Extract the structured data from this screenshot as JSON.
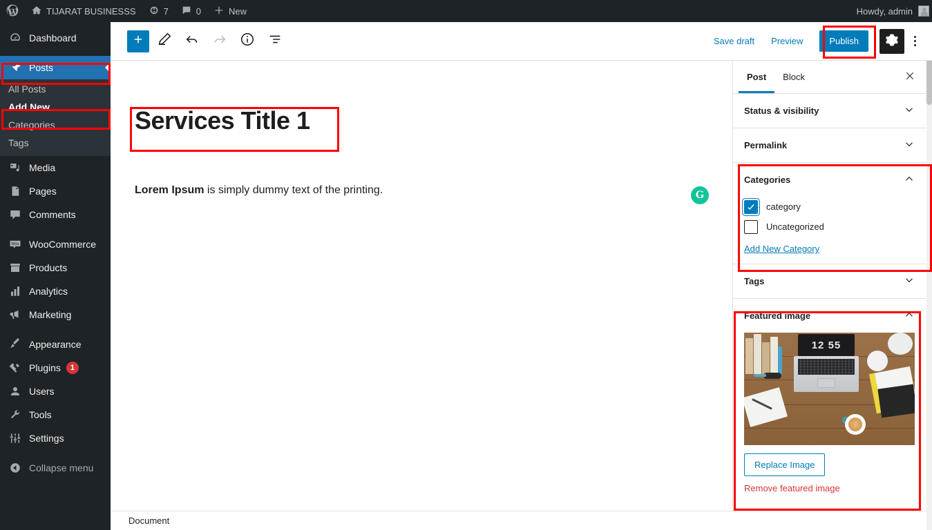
{
  "adminbar": {
    "logo_icon": "wordpress-icon",
    "site_icon": "home-icon",
    "site_name": "TIJARAT BUSINESSS",
    "updates_icon": "updates-icon",
    "updates_count": "7",
    "comments_icon": "comment-icon",
    "comments_count": "0",
    "new_icon": "plus-icon",
    "new_label": "New",
    "howdy": "Howdy, admin"
  },
  "sidebar": {
    "items": [
      {
        "label": "Dashboard",
        "icon": "dashboard-icon"
      },
      {
        "label": "Posts",
        "icon": "pin-icon"
      },
      {
        "label": "Media",
        "icon": "media-icon"
      },
      {
        "label": "Pages",
        "icon": "pages-icon"
      },
      {
        "label": "Comments",
        "icon": "comment-icon"
      },
      {
        "label": "WooCommerce",
        "icon": "woocommerce-icon"
      },
      {
        "label": "Products",
        "icon": "products-icon"
      },
      {
        "label": "Analytics",
        "icon": "analytics-icon"
      },
      {
        "label": "Marketing",
        "icon": "megaphone-icon"
      },
      {
        "label": "Appearance",
        "icon": "brush-icon"
      },
      {
        "label": "Plugins",
        "icon": "plug-icon",
        "badge": "1"
      },
      {
        "label": "Users",
        "icon": "user-icon"
      },
      {
        "label": "Tools",
        "icon": "wrench-icon"
      },
      {
        "label": "Settings",
        "icon": "sliders-icon"
      },
      {
        "label": "Collapse menu",
        "icon": "collapse-icon"
      }
    ],
    "posts_submenu": [
      {
        "label": "All Posts"
      },
      {
        "label": "Add New"
      },
      {
        "label": "Categories"
      },
      {
        "label": "Tags"
      }
    ]
  },
  "toolbar": {
    "add_block_icon": "plus-icon",
    "tools_icon": "pencil-icon",
    "undo_icon": "undo-icon",
    "redo_icon": "redo-icon",
    "info_icon": "info-icon",
    "list_view_icon": "list-view-icon",
    "save_draft": "Save draft",
    "preview": "Preview",
    "publish": "Publish",
    "settings_icon": "gear-icon",
    "more_icon": "three-dots-icon"
  },
  "editor": {
    "title": "Services Title 1",
    "body_bold": "Lorem Ipsum",
    "body_rest": " is simply dummy text of the printing.",
    "grammarly_icon": "grammarly-icon",
    "grammarly_letter": "G"
  },
  "settings_panel": {
    "tabs": [
      {
        "label": "Post",
        "active": true
      },
      {
        "label": "Block",
        "active": false
      }
    ],
    "close_icon": "close-icon",
    "panels": [
      {
        "title": "Status & visibility",
        "expanded": false
      },
      {
        "title": "Permalink",
        "expanded": false
      },
      {
        "title": "Categories",
        "expanded": true
      },
      {
        "title": "Tags",
        "expanded": false
      },
      {
        "title": "Featured image",
        "expanded": true
      }
    ],
    "categories": {
      "title": "Categories",
      "items": [
        {
          "label": "category",
          "checked": true
        },
        {
          "label": "Uncategorized",
          "checked": false
        }
      ],
      "add_new_link": "Add New Category"
    },
    "featured_image": {
      "title": "Featured image",
      "image_alt_clock": "12 55",
      "replace_label": "Replace Image",
      "remove_label": "Remove featured image"
    }
  },
  "footer": {
    "document_label": "Document"
  },
  "colors": {
    "admin_dark": "#1d2327",
    "admin_current_blue": "#2271b1",
    "wp_blue": "#007cba",
    "annotation_red": "#ff0000",
    "badge_red": "#d63638",
    "grammarly_green": "#15c39a",
    "remove_red": "#d63638"
  }
}
